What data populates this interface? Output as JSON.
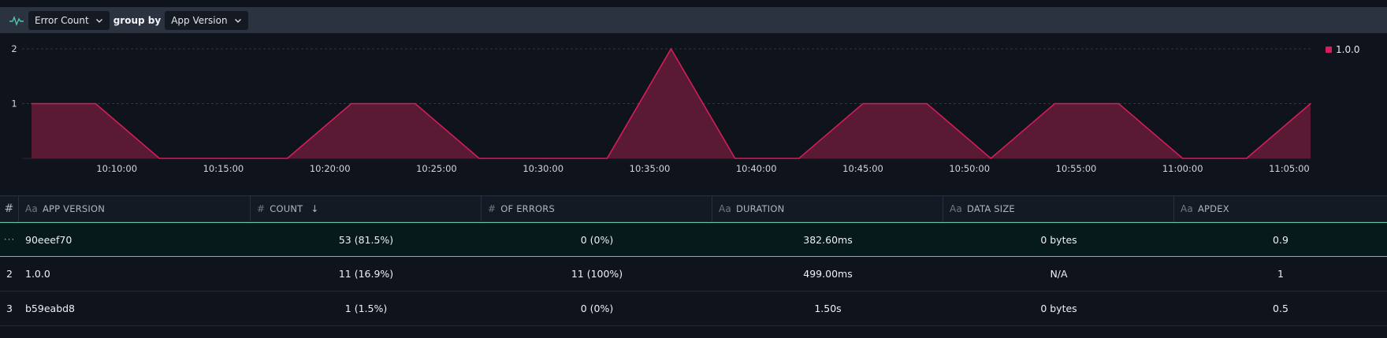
{
  "toolbar": {
    "metric": "Error Count",
    "group_by_label": "group by",
    "group_by_value": "App Version"
  },
  "legend": {
    "label": "1.0.0",
    "color": "#d41d5a"
  },
  "chart_data": {
    "type": "area",
    "series": [
      {
        "name": "1.0.0",
        "color": "#d41d5a",
        "x": [
          "10:06:00",
          "10:09:00",
          "10:12:00",
          "10:15:00",
          "10:18:00",
          "10:21:00",
          "10:24:00",
          "10:27:00",
          "10:30:00",
          "10:33:00",
          "10:36:00",
          "10:39:00",
          "10:42:00",
          "10:45:00",
          "10:48:00",
          "10:51:00",
          "10:54:00",
          "10:57:00",
          "11:00:00",
          "11:03:00",
          "11:06:00"
        ],
        "values": [
          1,
          1,
          0,
          0,
          0,
          1,
          1,
          0,
          0,
          0,
          2,
          0,
          0,
          1,
          1,
          0,
          1,
          1,
          0,
          0,
          1
        ]
      }
    ],
    "x_ticks": [
      "10:10:00",
      "10:15:00",
      "10:20:00",
      "10:25:00",
      "10:30:00",
      "10:35:00",
      "10:40:00",
      "10:45:00",
      "10:50:00",
      "10:55:00",
      "11:00:00",
      "11:05:00"
    ],
    "y_ticks": [
      "1",
      "2"
    ],
    "ylim": [
      0,
      2
    ],
    "grid": true,
    "legend_position": "top-right"
  },
  "table": {
    "columns": [
      {
        "icon": "#",
        "label": ""
      },
      {
        "icon": "Aa",
        "label": "APP VERSION"
      },
      {
        "icon": "#",
        "label": "COUNT",
        "sort": "desc"
      },
      {
        "icon": "#",
        "label": "OF ERRORS"
      },
      {
        "icon": "Aa",
        "label": "DURATION"
      },
      {
        "icon": "Aa",
        "label": "DATA SIZE"
      },
      {
        "icon": "Aa",
        "label": "APDEX"
      }
    ],
    "rows": [
      {
        "index": "···",
        "version": "90eeef70",
        "count": "53 (81.5%)",
        "errors": "0 (0%)",
        "duration": "382.60ms",
        "size": "0 bytes",
        "apdex": "0.9"
      },
      {
        "index": "2",
        "version": "1.0.0",
        "count": "11 (16.9%)",
        "errors": "11 (100%)",
        "duration": "499.00ms",
        "size": "N/A",
        "apdex": "1"
      },
      {
        "index": "3",
        "version": "b59eabd8",
        "count": "1 (1.5%)",
        "errors": "0 (0%)",
        "duration": "1.50s",
        "size": "0 bytes",
        "apdex": "0.5"
      }
    ]
  }
}
